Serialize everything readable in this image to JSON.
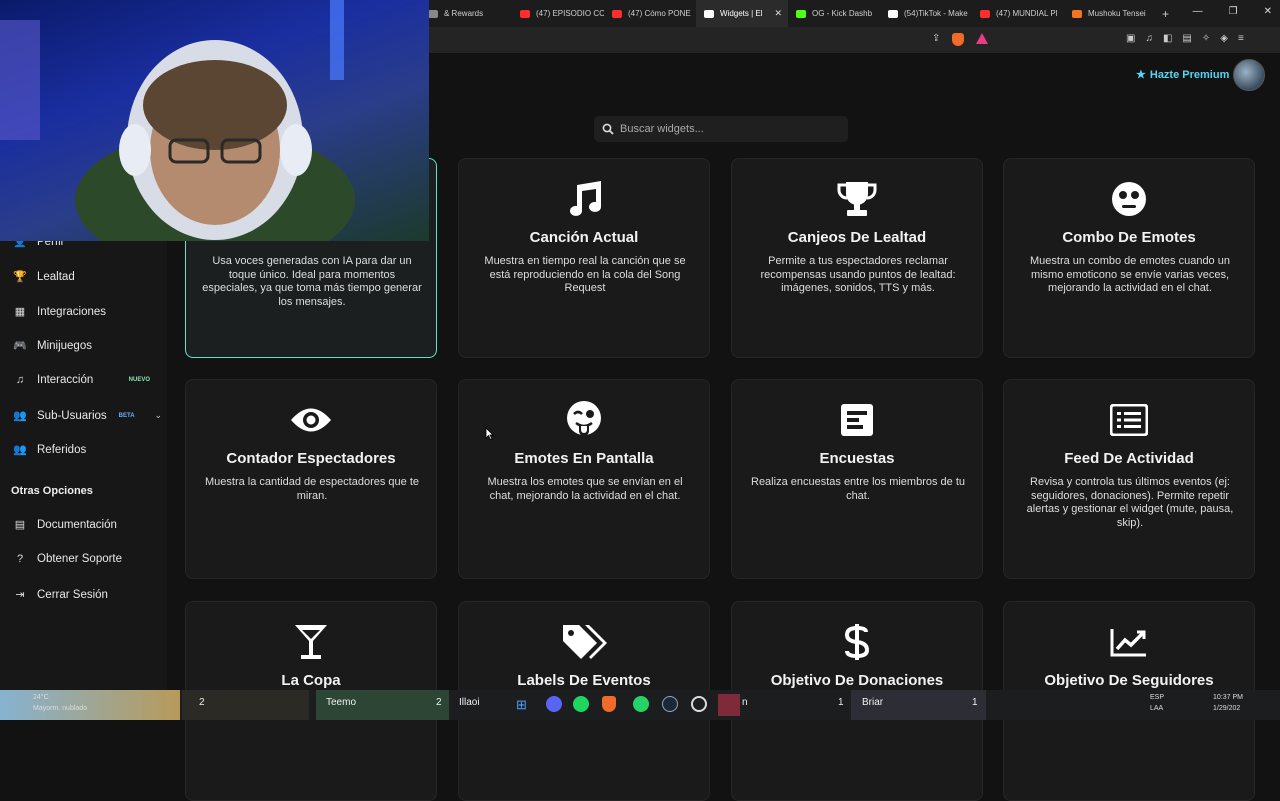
{
  "browser": {
    "tabs": [
      {
        "label": "& Rewards",
        "color": "#888888"
      },
      {
        "label": "(47) EPISODIO CC",
        "color": "#ff2d2d"
      },
      {
        "label": "(47) Cómo PONE",
        "color": "#ff2d2d"
      },
      {
        "label": "Widgets | El",
        "color": "#ffffff",
        "active": true
      },
      {
        "label": "OG - Kick Dashb",
        "color": "#53fc18"
      },
      {
        "label": "(54)TikTok - Make",
        "color": "#ffffff"
      },
      {
        "label": "(47) MUNDIAL Pl",
        "color": "#ff2d2d"
      },
      {
        "label": "Mushoku Tensei",
        "color": "#f47521"
      }
    ],
    "new_tab": "+",
    "window_controls": [
      "—",
      "❐",
      "✕"
    ]
  },
  "header": {
    "premium_label": "Hazte Premium"
  },
  "search": {
    "placeholder": "Buscar widgets..."
  },
  "sidebar": {
    "items": [
      {
        "label": "Perfil",
        "icon": "user-icon"
      },
      {
        "label": "Lealtad",
        "icon": "trophy-icon"
      },
      {
        "label": "Integraciones",
        "icon": "puzzle-icon"
      },
      {
        "label": "Minijuegos",
        "icon": "gamepad-icon"
      },
      {
        "label": "Interacción",
        "icon": "music-icon",
        "badge": "NUEVO"
      },
      {
        "label": "Sub-Usuarios",
        "icon": "users-icon",
        "badge": "BETA"
      },
      {
        "label": "Referidos",
        "icon": "users-icon"
      }
    ],
    "section_title": "Otras Opciones",
    "other_items": [
      {
        "label": "Documentación",
        "icon": "book-icon"
      },
      {
        "label": "Obtener Soporte",
        "icon": "help-icon"
      },
      {
        "label": "Cerrar Sesión",
        "icon": "logout-icon"
      }
    ]
  },
  "cards": [
    {
      "title": "",
      "desc": "Usa voces generadas con IA para dar un toque único. Ideal para momentos especiales, ya que toma más tiempo generar los mensajes.",
      "icon": "microphone-icon",
      "selected": true
    },
    {
      "title": "Canción Actual",
      "desc": "Muestra en tiempo real la canción que se está reproduciendo en la cola del Song Request",
      "icon": "music-icon"
    },
    {
      "title": "Canjeos De Lealtad",
      "desc": "Permite a tus espectadores reclamar recompensas usando puntos de lealtad: imágenes, sonidos, TTS y más.",
      "icon": "trophy-icon"
    },
    {
      "title": "Combo De Emotes",
      "desc": "Muestra un combo de emotes cuando un mismo emoticono se envíe varias veces, mejorando la actividad en el chat.",
      "icon": "face-icon"
    },
    {
      "title": "Contador Espectadores",
      "desc": "Muestra la cantidad de espectadores que te miran.",
      "icon": "eye-icon"
    },
    {
      "title": "Emotes En Pantalla",
      "desc": "Muestra los emotes que se envían en el chat, mejorando la actividad en el chat.",
      "icon": "wink-tongue-icon"
    },
    {
      "title": "Encuestas",
      "desc": "Realiza encuestas entre los miembros de tu chat.",
      "icon": "poll-icon"
    },
    {
      "title": "Feed De Actividad",
      "desc": "Revisa y controla tus últimos eventos (ej: seguidores, donaciones). Permite repetir alertas y gestionar el widget (mute, pausa, skip).",
      "icon": "list-icon"
    },
    {
      "title": "La Copa",
      "desc": "",
      "icon": "cocktail-icon"
    },
    {
      "title": "Labels De Eventos",
      "desc": "",
      "icon": "tags-icon"
    },
    {
      "title": "Objetivo De Donaciones",
      "desc": "",
      "icon": "dollar-icon"
    },
    {
      "title": "Objetivo De Seguidores",
      "desc": "",
      "icon": "chart-line-icon"
    }
  ],
  "taskbar": {
    "weather_temp": "24°C",
    "weather_desc": "Mayorm. nublado",
    "count_1": "2",
    "player_1": "Teemo",
    "count_2": "2",
    "player_2": "Illaoi",
    "player_3": "n",
    "count_3": "1",
    "player_4": "Briar",
    "count_4": "1",
    "lang_1": "ESP",
    "lang_2": "LAA",
    "time": "10:37 PM",
    "date": "1/29/202"
  }
}
